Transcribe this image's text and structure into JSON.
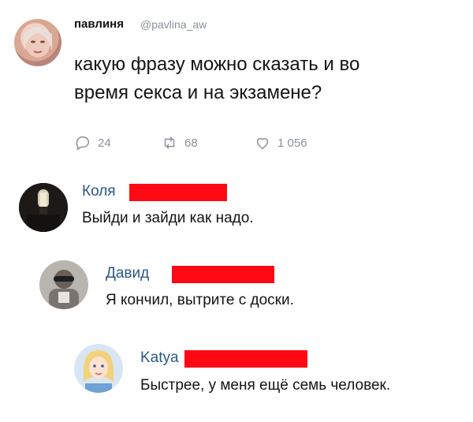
{
  "tweet": {
    "author_name": "павлиня",
    "author_handle": "@pavlina_aw",
    "text": "какую фразу можно сказать и во время секса и на экзамене?",
    "replies": "24",
    "retweets": "68",
    "likes": "1 056"
  },
  "comments": [
    {
      "name": "Коля",
      "text": "Выйди и зайди как надо."
    },
    {
      "name": "Давид",
      "text": "Я кончил, вытрите с доски."
    },
    {
      "name": "Katya",
      "text": "Быстрее, у меня ещё семь человек."
    }
  ],
  "colors": {
    "comment_name": "#2a5885",
    "redaction": "#ff0a14",
    "muted": "#8a9199"
  },
  "icons": [
    "reply-icon",
    "retweet-icon",
    "like-icon"
  ]
}
